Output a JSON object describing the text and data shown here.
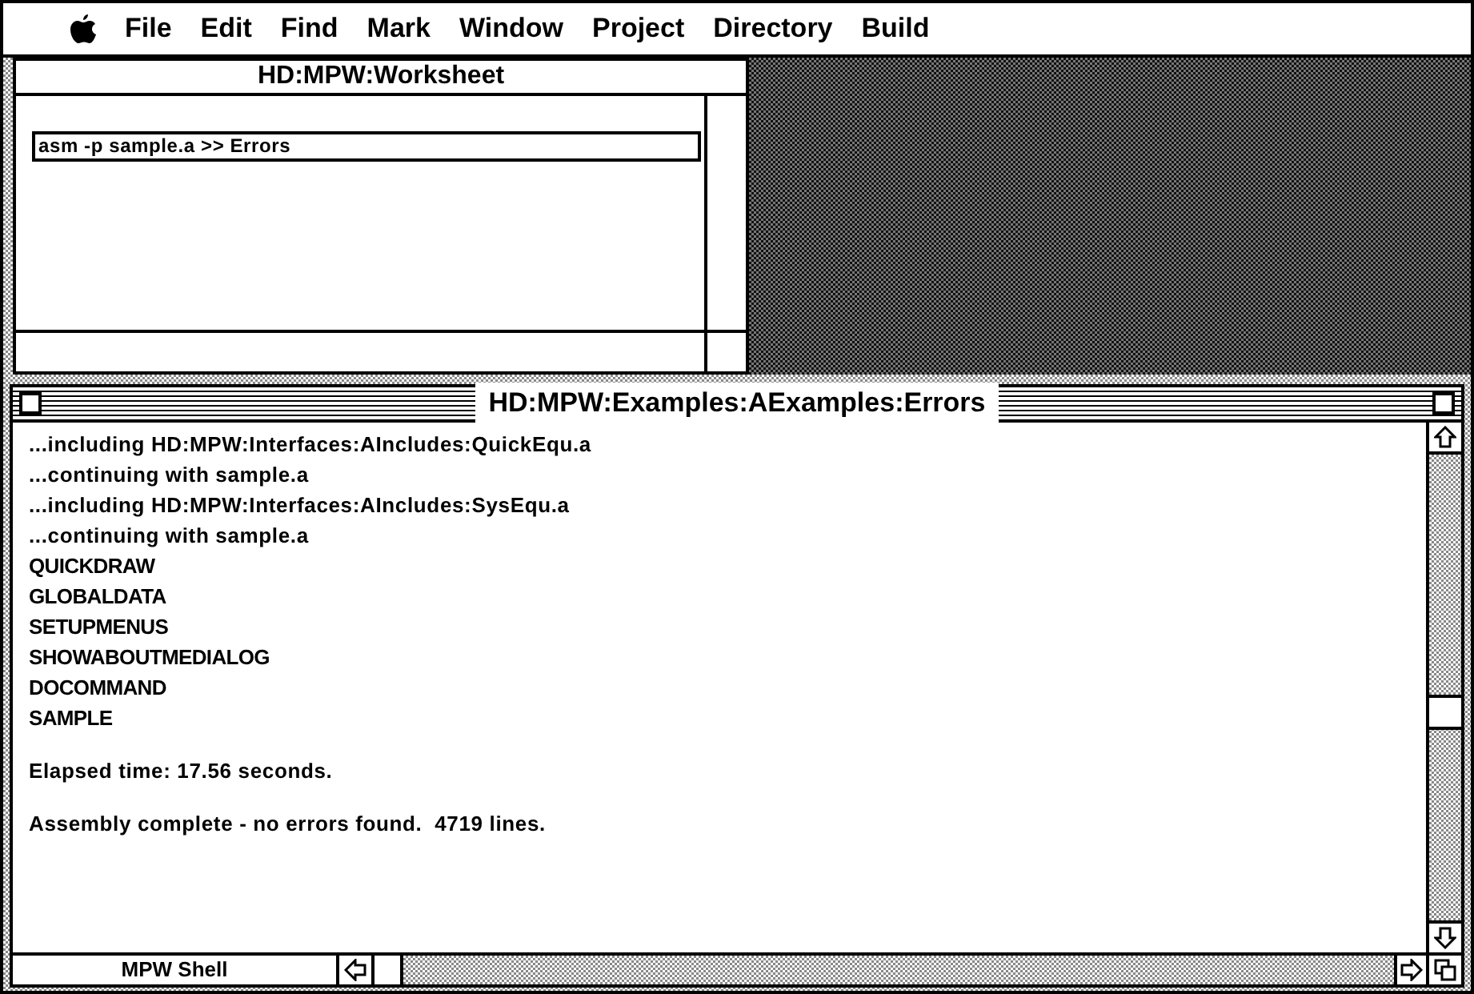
{
  "menu_bar": {
    "items": [
      "File",
      "Edit",
      "Find",
      "Mark",
      "Window",
      "Project",
      "Directory",
      "Build"
    ]
  },
  "worksheet": {
    "title": "HD:MPW:Worksheet",
    "command": "asm -p sample.a >> Errors"
  },
  "errors_window": {
    "title": "HD:MPW:Examples:AExamples:Errors",
    "lines": [
      {
        "kind": "message",
        "text": "...including HD:MPW:Interfaces:AIncludes:QuickEqu.a"
      },
      {
        "kind": "message",
        "text": "...continuing with sample.a"
      },
      {
        "kind": "message",
        "text": "...including HD:MPW:Interfaces:AIncludes:SysEqu.a"
      },
      {
        "kind": "message",
        "text": "...continuing with sample.a"
      },
      {
        "kind": "symbol",
        "text": "QUICKDRAW"
      },
      {
        "kind": "symbol",
        "text": "GLOBALDATA"
      },
      {
        "kind": "symbol",
        "text": "SETUPMENUS"
      },
      {
        "kind": "symbol",
        "text": "SHOWABOUTMEDIALOG"
      },
      {
        "kind": "symbol",
        "text": "DOCOMMAND"
      },
      {
        "kind": "symbol",
        "text": "SAMPLE"
      },
      {
        "kind": "summary",
        "text": "Elapsed time: 17.56 seconds."
      },
      {
        "kind": "summary",
        "text": "Assembly complete - no errors found.  4719 lines."
      }
    ],
    "status": "MPW Shell"
  }
}
